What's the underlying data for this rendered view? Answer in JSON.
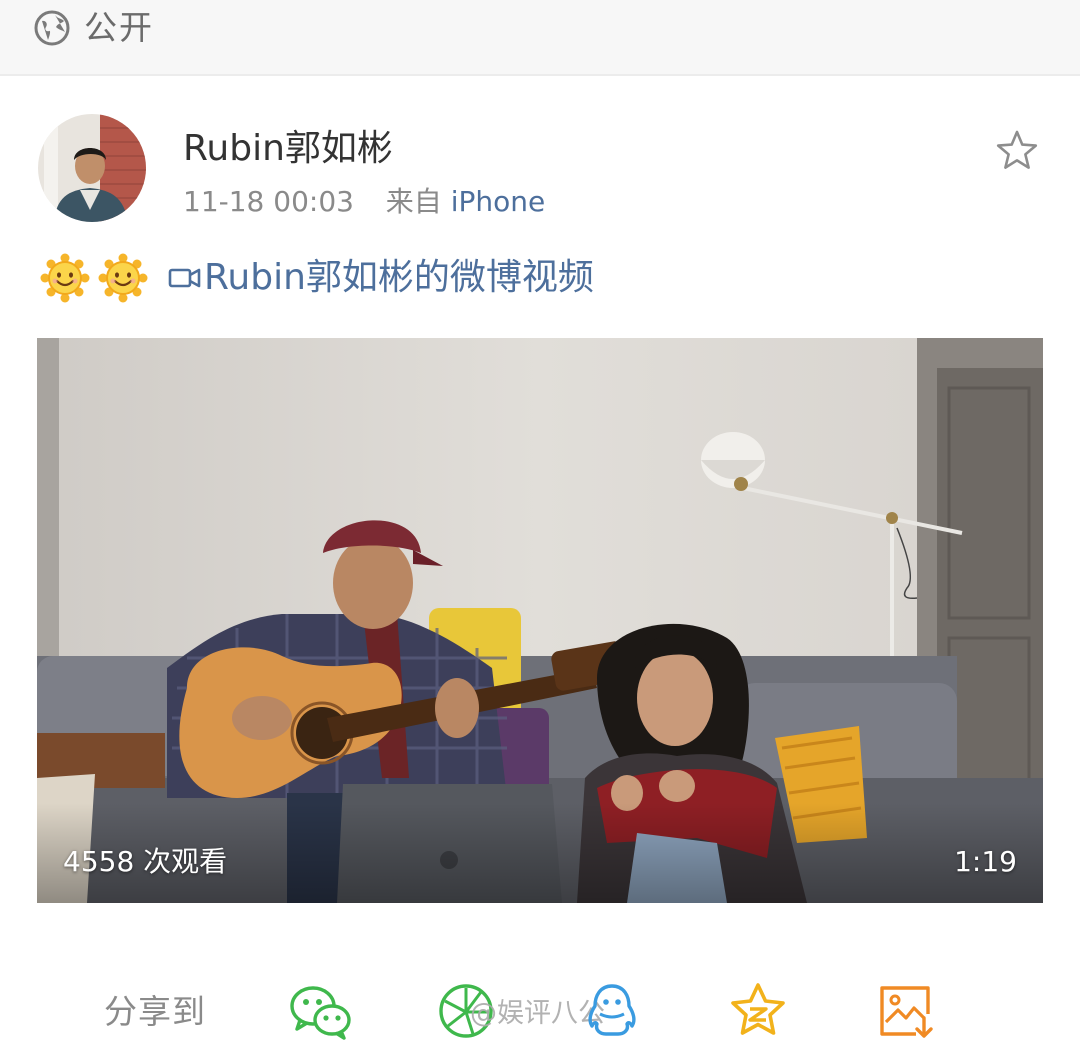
{
  "top_bar": {
    "visibility": "公开",
    "icon": "globe-icon"
  },
  "post": {
    "user_name": "Rubin郭如彬",
    "time": "11-18 00:03",
    "source_prefix": "来自",
    "source_device": "iPhone",
    "emojis": [
      "sun-emoji",
      "sun-emoji"
    ],
    "video_link_text": "Rubin郭如彬的微博视频",
    "favorite_icon": "star-outline-icon"
  },
  "video": {
    "view_count": "4558 次观看",
    "duration": "1:19"
  },
  "share_bar": {
    "label": "分享到",
    "targets": [
      "wechat-icon",
      "wechat-moments-icon",
      "qq-icon",
      "qzone-icon",
      "save-image-icon"
    ],
    "watermark": "@娱评八公"
  },
  "colors": {
    "link": "#4d6f9c",
    "wechat_green": "#3fb84c",
    "qq_blue": "#3a9be0",
    "qzone_yellow": "#f2b21b",
    "save_orange": "#f08a24"
  }
}
